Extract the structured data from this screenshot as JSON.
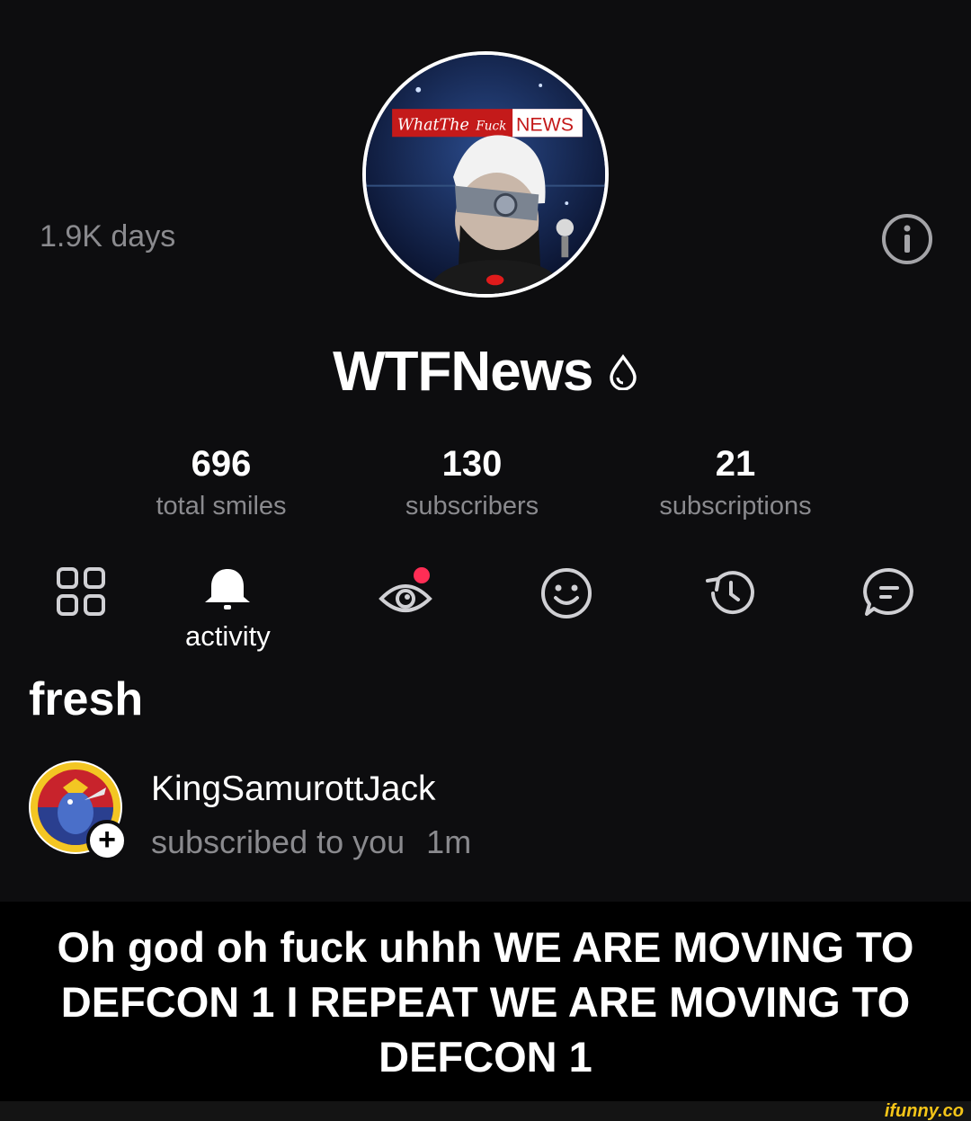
{
  "profile": {
    "days": "1.9K days",
    "username": "WTFNews",
    "avatar_banner": {
      "what": "What",
      "the": "The",
      "fuck": "Fuck",
      "news": "NEWS"
    }
  },
  "stats": [
    {
      "value": "696",
      "label": "total smiles"
    },
    {
      "value": "130",
      "label": "subscribers"
    },
    {
      "value": "21",
      "label": "subscriptions"
    }
  ],
  "tabs": {
    "activity_label": "activity"
  },
  "section": {
    "title": "fresh"
  },
  "notification": {
    "name": "KingSamurottJack",
    "text": "subscribed to you",
    "time": "1m"
  },
  "caption": "Oh god oh fuck uhhh WE ARE MOVING TO DEFCON 1 I REPEAT WE ARE MOVING TO DEFCON 1",
  "watermark": "ifunny.co",
  "colors": {
    "background": "#0d0d0f",
    "muted_text": "#8a8a8e",
    "notification_dot": "#ff2d55",
    "watermark": "#f5c518"
  }
}
